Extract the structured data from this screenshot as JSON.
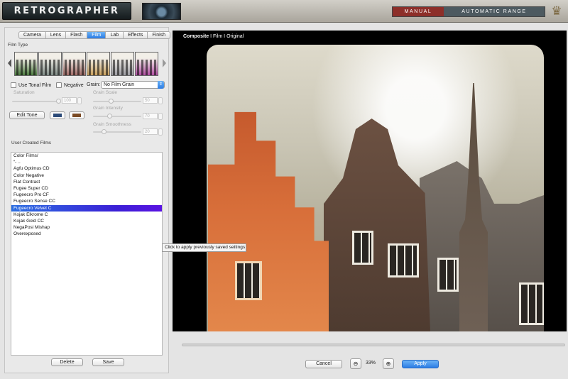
{
  "header": {
    "logo": "RETROGRAPHER",
    "mode_manual": "MANUAL",
    "mode_auto": "AUTOMATIC RANGE",
    "crown_icon": "crown-icon"
  },
  "tabs": [
    {
      "label": "Camera",
      "active": false
    },
    {
      "label": "Lens",
      "active": false
    },
    {
      "label": "Flash",
      "active": false
    },
    {
      "label": "Film",
      "active": true
    },
    {
      "label": "Lab",
      "active": false
    },
    {
      "label": "Effects",
      "active": false
    },
    {
      "label": "Finish",
      "active": false
    }
  ],
  "film": {
    "section_title": "Film Type",
    "thumb_tints": [
      "#4a7a3e",
      "#7e8b86",
      "#9f6a66",
      "#c9a05d",
      "#9a9aa0",
      "#b04da2"
    ],
    "use_tonal_film": "Use Tonal Film",
    "negative": "Negative",
    "grain_label": "Grain:",
    "grain_value": "No Film Grain",
    "saturation": {
      "label": "Saturation",
      "value": "100"
    },
    "grain_scale": {
      "label": "Grain Scale",
      "value": "50"
    },
    "grain_intensity": {
      "label": "Grain Intensity",
      "value": "70"
    },
    "grain_smoothness": {
      "label": "Grain Smoothness",
      "value": "20"
    },
    "edit_tone": "Edit Tone",
    "swatch_colors": [
      "#2c4a78",
      "#7a4a24"
    ]
  },
  "user_films": {
    "section_title": "User Created Films",
    "items": [
      "Color Films/",
      "“- ..",
      "Agfu Optimus CD",
      "Color Negative",
      "Flat Contrast",
      "Fugee Super CD",
      "Fugeecro Pro CF",
      "Fugeecro Sense CC",
      "Fugeecro Velvet C",
      "Kojak Elkrome C",
      "Kojak Gold CC",
      "NegaPosi Mishap",
      "Overexposed"
    ],
    "selected_index": 8,
    "delete": "Delete",
    "save": "Save"
  },
  "tooltip": "Click to apply previously saved settings",
  "preview": {
    "view_active": "Composite",
    "view_sep1": " I ",
    "view_film": "Film",
    "view_sep2": " I ",
    "view_original": "Original"
  },
  "footer": {
    "cancel": "Cancel",
    "zoom": "33%",
    "apply": "Apply",
    "zoom_out_icon": "zoom-out-icon",
    "zoom_in_icon": "zoom-in-icon"
  }
}
